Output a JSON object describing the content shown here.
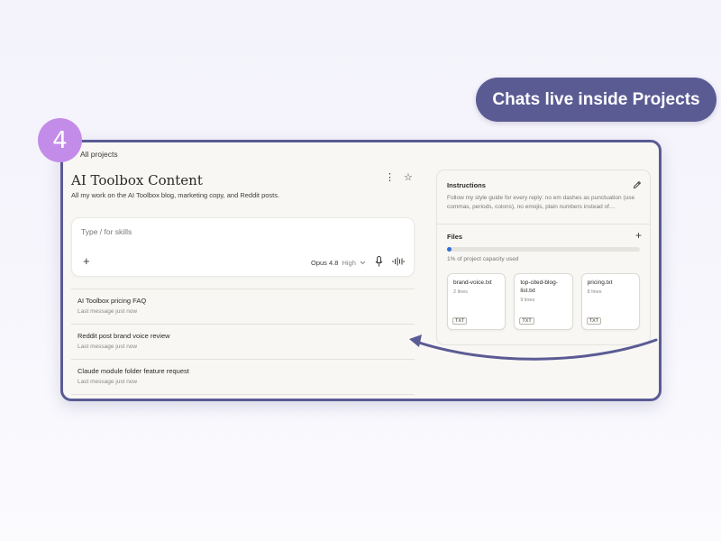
{
  "callout": "Chats live inside Projects",
  "step_number": "4",
  "breadcrumb": "All projects",
  "project": {
    "title": "AI Toolbox Content",
    "description": "All my work on the AI Toolbox blog, marketing copy, and Reddit posts."
  },
  "composer": {
    "placeholder": "Type / for skills",
    "model": "Opus 4.8",
    "effort": "High"
  },
  "chats": [
    {
      "title": "AI Toolbox pricing FAQ",
      "meta": "Last message just now"
    },
    {
      "title": "Reddit post brand voice review",
      "meta": "Last message just now"
    },
    {
      "title": "Claude module folder feature request",
      "meta": "Last message just now"
    }
  ],
  "instructions": {
    "title": "Instructions",
    "text": "Follow my style guide for every reply: no em dashes as punctuation (use commas, periods, colons), no emojis, plain numbers instead of…"
  },
  "files": {
    "title": "Files",
    "capacity_fraction": 0.01,
    "capacity_text": "1% of project capacity used",
    "items": [
      {
        "name": "brand-voice.txt",
        "lines": "2 lines",
        "type": "TXT"
      },
      {
        "name": "top-cited-blog-list.txt",
        "lines": "9 lines",
        "type": "TXT"
      },
      {
        "name": "pricing.txt",
        "lines": "8 lines",
        "type": "TXT"
      }
    ]
  },
  "colors": {
    "accent": "#5b5b94",
    "badge": "#c28ce8",
    "capacity_fill": "#2f6fd6"
  }
}
